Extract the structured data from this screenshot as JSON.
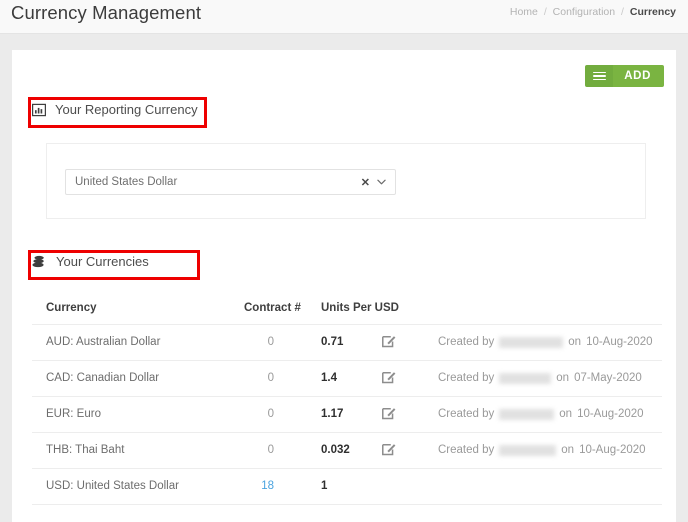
{
  "header": {
    "title": "Currency Management",
    "breadcrumb": {
      "items": [
        "Home",
        "Configuration"
      ],
      "current": "Currency",
      "separator": "/"
    }
  },
  "toolbar": {
    "add_label": "ADD",
    "add_icon": "hamburger-menu-icon"
  },
  "sections": {
    "reporting": {
      "heading": "Your Reporting Currency",
      "icon": "bar-chart-icon",
      "highlighted": true,
      "highlight_color": "#ee0000",
      "select": {
        "value": "United States Dollar",
        "clear_icon": "close-x-icon",
        "caret_icon": "chevron-down-icon"
      }
    },
    "currencies": {
      "heading": "Your Currencies",
      "icon": "coins-stack-icon",
      "highlighted": true,
      "highlight_color": "#ee0000"
    }
  },
  "table": {
    "columns": [
      "Currency",
      "Contract #",
      "Units Per USD"
    ],
    "created_prefix": "Created by",
    "created_mid": "on",
    "rows": [
      {
        "currency": "AUD: Australian Dollar",
        "contract": "0",
        "contract_link": false,
        "units": "0.71",
        "editable": true,
        "created_by_redacted_width": 64,
        "created_on": "10-Aug-2020"
      },
      {
        "currency": "CAD: Canadian Dollar",
        "contract": "0",
        "contract_link": false,
        "units": "1.4",
        "editable": true,
        "created_by_redacted_width": 52,
        "created_on": "07-May-2020"
      },
      {
        "currency": "EUR: Euro",
        "contract": "0",
        "contract_link": false,
        "units": "1.17",
        "editable": true,
        "created_by_redacted_width": 55,
        "created_on": "10-Aug-2020"
      },
      {
        "currency": "THB: Thai Baht",
        "contract": "0",
        "contract_link": false,
        "units": "0.032",
        "editable": true,
        "created_by_redacted_width": 57,
        "created_on": "10-Aug-2020"
      },
      {
        "currency": "USD: United States Dollar",
        "contract": "18",
        "contract_link": true,
        "units": "1",
        "editable": false,
        "created_by_redacted_width": 0,
        "created_on": ""
      }
    ]
  },
  "colors": {
    "accent_green": "#7ab441",
    "link_blue": "#4aa3df",
    "annotation_red": "#ee0000",
    "page_background": "#ebebeb"
  }
}
